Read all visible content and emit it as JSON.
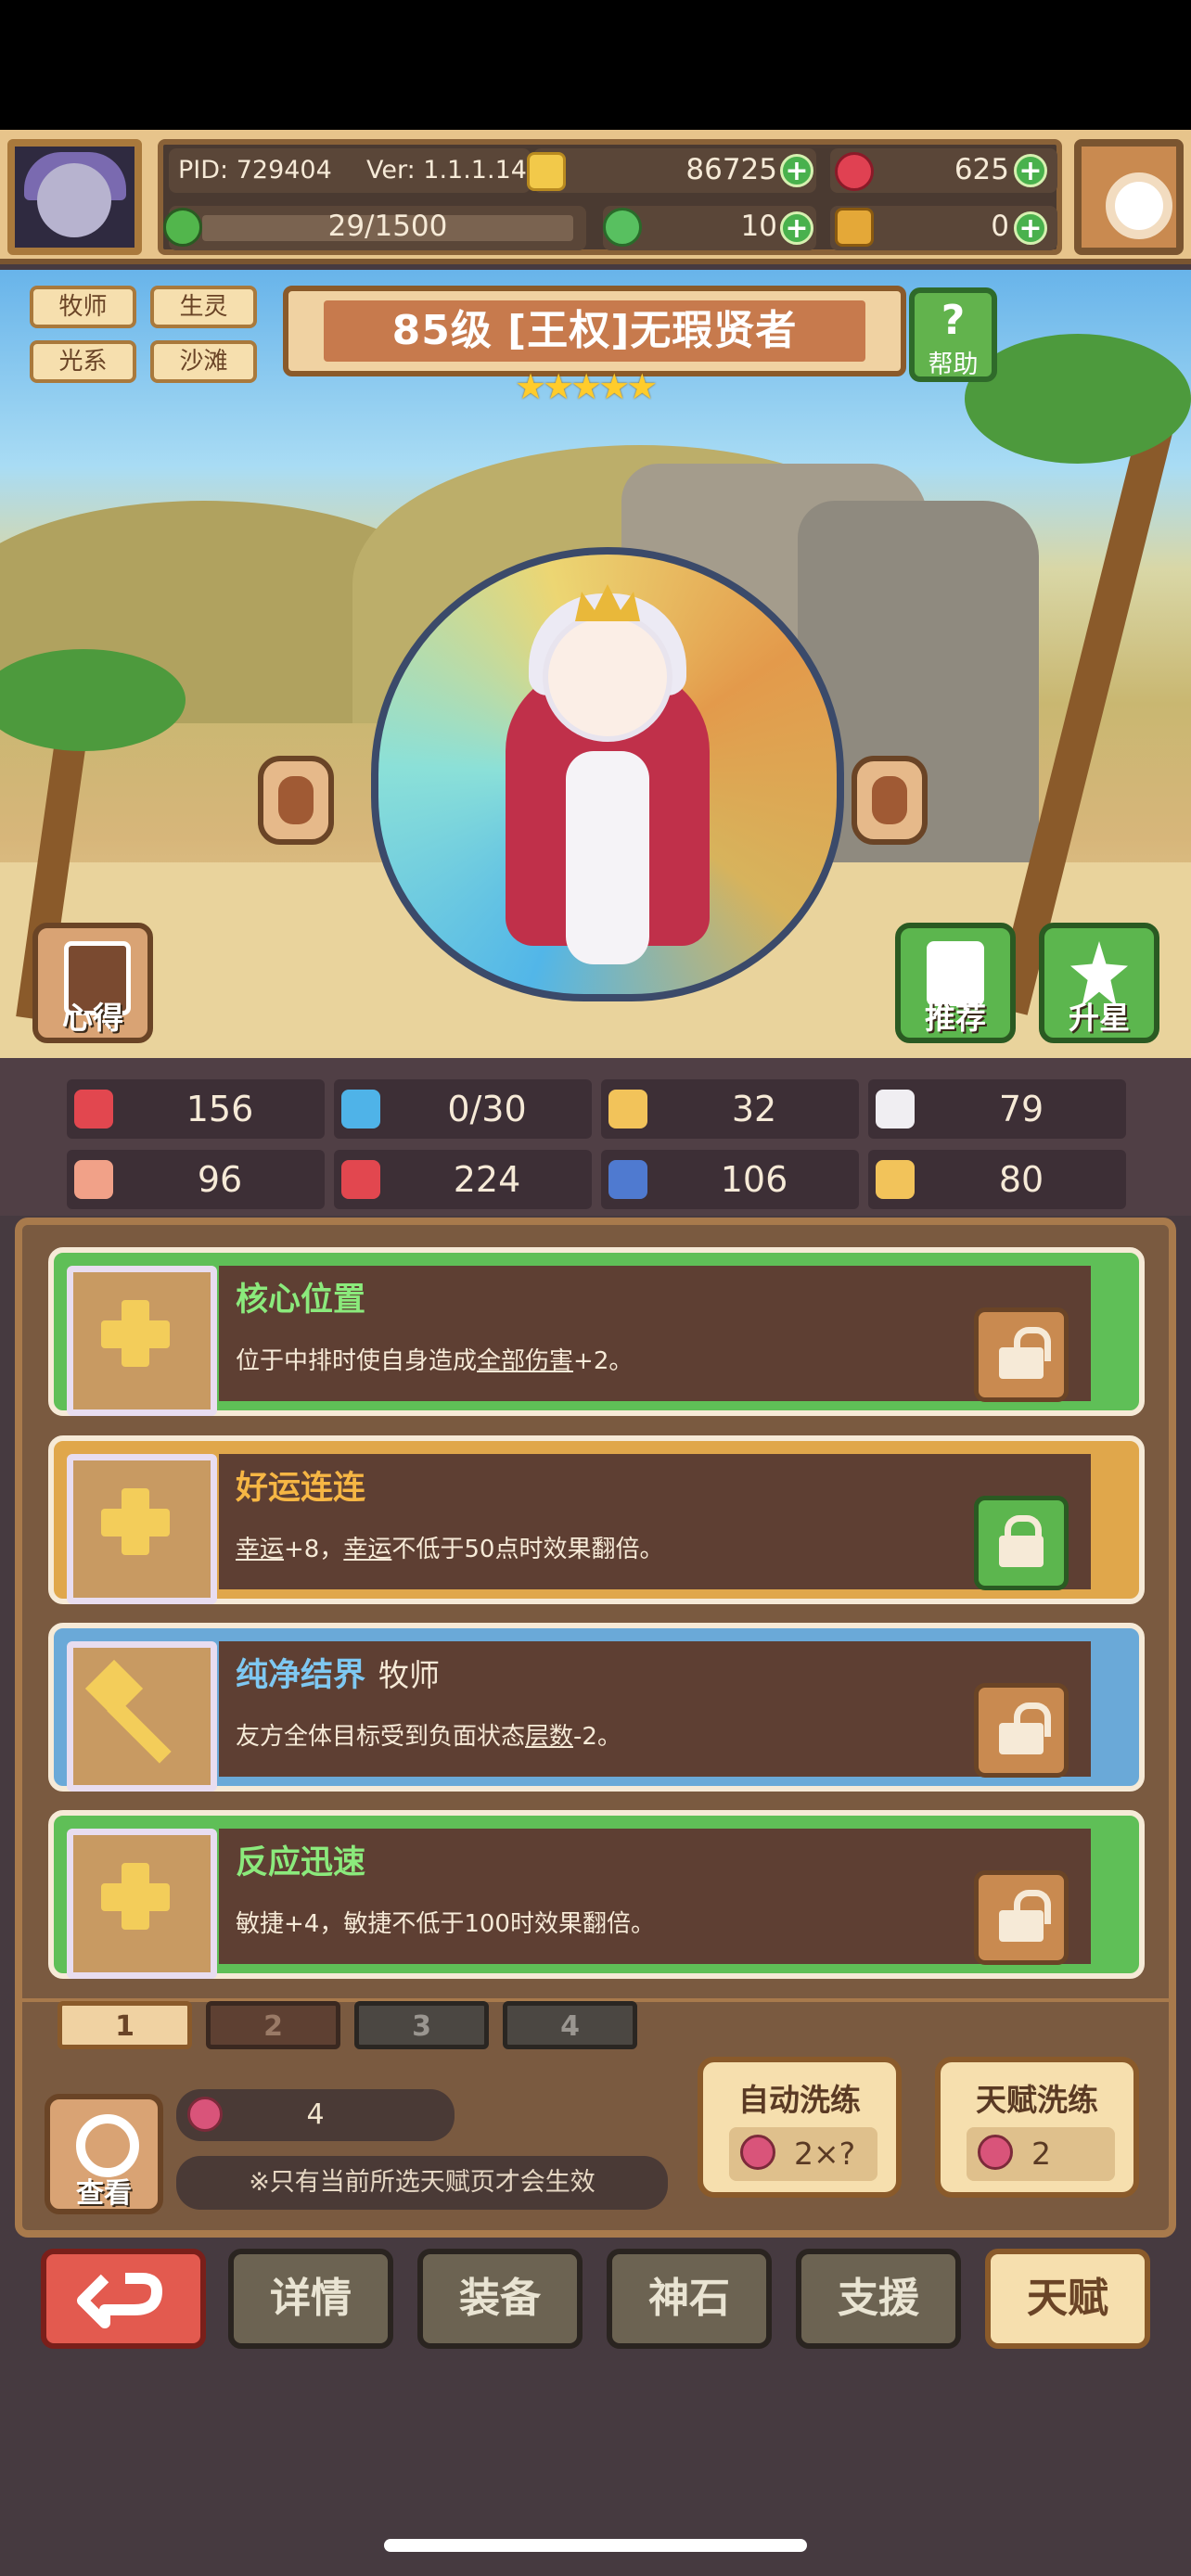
{
  "header": {
    "pid": "PID: 729404",
    "version": "Ver: 1.1.1.14",
    "energy": "29/1500",
    "coins": "86725",
    "gems": "625",
    "clover": "10",
    "ticket": "0"
  },
  "hero": {
    "tags": [
      "牧师",
      "生灵",
      "光系",
      "沙滩"
    ],
    "title": "85级 [王权]无瑕贤者",
    "stars": "★★★★★",
    "help_label": "帮助",
    "left_button": "心得",
    "recommend_button": "推荐",
    "star_up_button": "升星"
  },
  "stats": [
    {
      "icon": "heart-icon",
      "value": "156",
      "color": "#e2474f"
    },
    {
      "icon": "mana-drop-icon",
      "value": "0/30",
      "color": "#4fb3e8"
    },
    {
      "icon": "shield-icon",
      "value": "32",
      "color": "#f2c35a"
    },
    {
      "icon": "wing-icon",
      "value": "79",
      "color": "#f0eef2"
    },
    {
      "icon": "fist-icon",
      "value": "96",
      "color": "#f1a188"
    },
    {
      "icon": "spellbook-icon",
      "value": "224",
      "color": "#e2474f"
    },
    {
      "icon": "boot-icon",
      "value": "106",
      "color": "#4f7ad0"
    },
    {
      "icon": "horseshoe-icon",
      "value": "80",
      "color": "#f2c35a"
    }
  ],
  "talents": [
    {
      "name": "核心位置",
      "class": "",
      "name_color": "#8bea7c",
      "border": "#5fbf57",
      "desc_pre": "位于中排时使自身造成",
      "desc_u1": "全部伤害",
      "desc_mid": "+2。",
      "desc_u2": "",
      "desc_post": "",
      "icon": "cross-icon",
      "lock": "unlocked",
      "lock_color": "#c98a50"
    },
    {
      "name": "好运连连",
      "class": "",
      "name_color": "#f6b644",
      "border": "#e0a74b",
      "desc_pre": "",
      "desc_u1": "幸运",
      "desc_mid": "+8，",
      "desc_u2": "幸运",
      "desc_post": "不低于50点时效果翻倍。",
      "icon": "cross-icon",
      "lock": "locked",
      "lock_color": "#5cb64e"
    },
    {
      "name": "纯净结界",
      "class": "牧师",
      "name_color": "#7ec8f2",
      "border": "#6aa9d8",
      "desc_pre": "友方全体目标受到负面状态",
      "desc_u1": "层数",
      "desc_mid": "-2。",
      "desc_u2": "",
      "desc_post": "",
      "icon": "hammer-icon",
      "lock": "unlocked",
      "lock_color": "#c98a50"
    },
    {
      "name": "反应迅速",
      "class": "",
      "name_color": "#8bea7c",
      "border": "#5fbf57",
      "desc_pre": "敏捷+4，敏捷不低于100时效果翻倍。",
      "desc_u1": "",
      "desc_mid": "",
      "desc_u2": "",
      "desc_post": "",
      "icon": "cross-icon",
      "lock": "unlocked",
      "lock_color": "#c98a50"
    }
  ],
  "pages": [
    "1",
    "2",
    "3",
    "4"
  ],
  "footer": {
    "view_label": "查看",
    "cost": "4",
    "notice": "※只有当前所选天赋页才会生效",
    "auto_wash_label": "自动洗练",
    "auto_wash_cost": "2×?",
    "talent_wash_label": "天赋洗练",
    "talent_wash_cost": "2"
  },
  "nav": {
    "back_icon": "back-arrow-icon",
    "items": [
      "详情",
      "装备",
      "神石",
      "支援",
      "天赋"
    ]
  }
}
